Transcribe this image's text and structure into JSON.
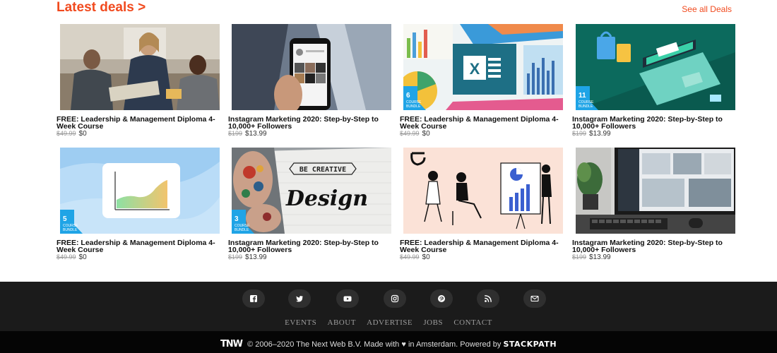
{
  "section": {
    "title": "Latest deals >",
    "see_all": "See all Deals",
    "accent_color": "#f14a1e"
  },
  "deals": [
    {
      "title": "FREE: Leadership & Management Diploma 4-Week Course",
      "old_price": "$49.99",
      "price": "$0",
      "image": "business-team-meeting-photo"
    },
    {
      "title": "Instagram Marketing 2020: Step-by-Step to 10,000+ Followers",
      "old_price": "$199",
      "price": "$13.99",
      "image": "phone-instagram-photo"
    },
    {
      "title": "FREE: Leadership & Management Diploma 4-Week Course",
      "old_price": "$49.99",
      "price": "$0",
      "image": "excel-charts-illustration",
      "bundle_count": "6",
      "bundle_label": "COURSE BUNDLE"
    },
    {
      "title": "Instagram Marketing 2020: Step-by-Step to 10,000+ Followers",
      "old_price": "$199",
      "price": "$13.99",
      "image": "ecommerce-laptop-illustration",
      "bundle_count": "11",
      "bundle_label": "COURSE BUNDLE"
    },
    {
      "title": "FREE: Leadership & Management Diploma 4-Week Course",
      "old_price": "$49.99",
      "price": "$0",
      "image": "area-chart-card-illustration",
      "bundle_count": "5",
      "bundle_label": "COURSE BUNDLE"
    },
    {
      "title": "Instagram Marketing 2020: Step-by-Step to 10,000+ Followers",
      "old_price": "$199",
      "price": "$13.99",
      "image": "be-creative-design-photo",
      "bundle_count": "3",
      "bundle_label": "COURSE BUNDLE",
      "image_text_1": "BE CREATIVE",
      "image_text_2": "Design"
    },
    {
      "title": "FREE: Leadership & Management Diploma 4-Week Course",
      "old_price": "$49.99",
      "price": "$0",
      "image": "people-presentation-illustration"
    },
    {
      "title": "Instagram Marketing 2020: Step-by-Step to 10,000+ Followers",
      "old_price": "$199",
      "price": "$13.99",
      "image": "desk-monitor-photo"
    }
  ],
  "footer": {
    "social_icons": [
      "facebook-icon",
      "twitter-icon",
      "youtube-icon",
      "instagram-icon",
      "pinterest-icon",
      "rss-icon",
      "mail-icon"
    ],
    "nav": [
      "EVENTS",
      "ABOUT",
      "ADVERTISE",
      "JOBS",
      "CONTACT"
    ],
    "logo": "TNW",
    "copyright": "© 2006–2020 The Next Web B.V. Made with ♥ in Amsterdam. Powered by",
    "powered_by": "STACKPATH"
  }
}
